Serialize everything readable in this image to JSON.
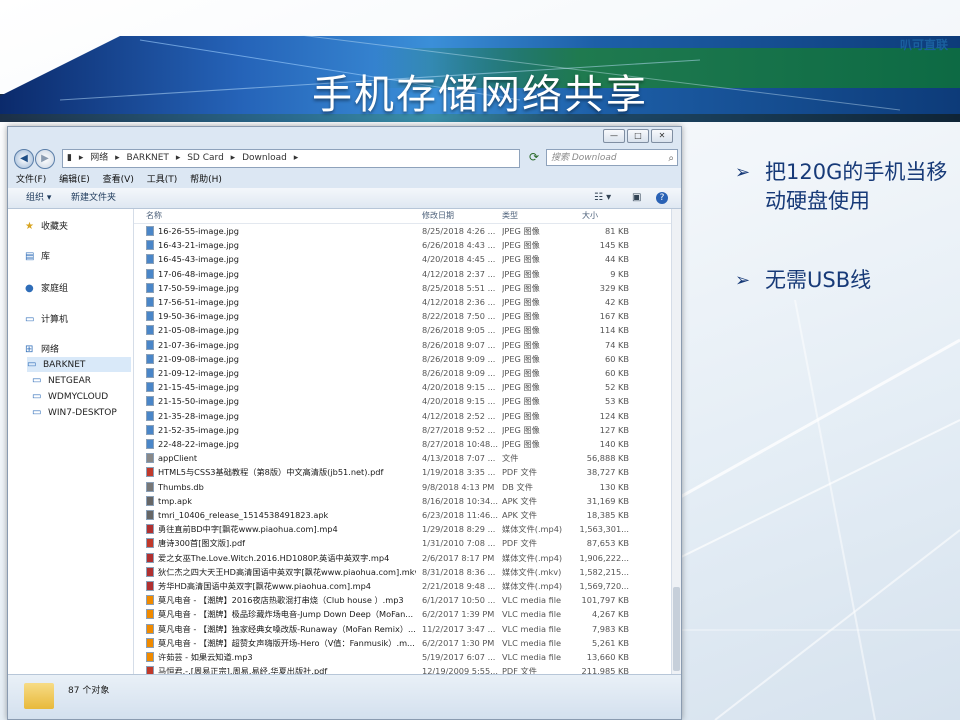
{
  "slide": {
    "brand": "叭可直联",
    "title": "手机存储网络共享",
    "bullets": [
      {
        "marker": "➢",
        "text": "把120G的手机当移动硬盘使用"
      },
      {
        "marker": "➢",
        "text": "无需USB线"
      }
    ]
  },
  "window": {
    "controls": {
      "minimize": "—",
      "maximize": "□",
      "close": "✕"
    },
    "breadcrumb": [
      "网络",
      "BARKNET",
      "SD Card",
      "Download"
    ],
    "search_placeholder": "搜索 Download",
    "menu": [
      "文件(F)",
      "编辑(E)",
      "查看(V)",
      "工具(T)",
      "帮助(H)"
    ],
    "commands": {
      "organize": "组织 ▾",
      "new_folder": "新建文件夹"
    },
    "columns": {
      "name": "名称",
      "date": "修改日期",
      "type": "类型",
      "size": "大小"
    },
    "nav": {
      "favorites": "收藏夹",
      "libraries": "库",
      "homegroup": "家庭组",
      "computer": "计算机",
      "network": "网络",
      "hosts": [
        "BARKNET",
        "NETGEAR",
        "WDMYCLOUD",
        "WIN7-DESKTOP"
      ]
    },
    "files": [
      {
        "name": "16-26-55-image.jpg",
        "date": "8/25/2018 4:26 ...",
        "type": "JPEG 图像",
        "size": "81 KB"
      },
      {
        "name": "16-43-21-image.jpg",
        "date": "6/26/2018 4:43 ...",
        "type": "JPEG 图像",
        "size": "145 KB"
      },
      {
        "name": "16-45-43-image.jpg",
        "date": "4/20/2018 4:45 ...",
        "type": "JPEG 图像",
        "size": "44 KB"
      },
      {
        "name": "17-06-48-image.jpg",
        "date": "4/12/2018 2:37 ...",
        "type": "JPEG 图像",
        "size": "9 KB"
      },
      {
        "name": "17-50-59-image.jpg",
        "date": "8/25/2018 5:51 ...",
        "type": "JPEG 图像",
        "size": "329 KB"
      },
      {
        "name": "17-56-51-image.jpg",
        "date": "4/12/2018 2:36 ...",
        "type": "JPEG 图像",
        "size": "42 KB"
      },
      {
        "name": "19-50-36-image.jpg",
        "date": "8/22/2018 7:50 ...",
        "type": "JPEG 图像",
        "size": "167 KB"
      },
      {
        "name": "21-05-08-image.jpg",
        "date": "8/26/2018 9:05 ...",
        "type": "JPEG 图像",
        "size": "114 KB"
      },
      {
        "name": "21-07-36-image.jpg",
        "date": "8/26/2018 9:07 ...",
        "type": "JPEG 图像",
        "size": "74 KB"
      },
      {
        "name": "21-09-08-image.jpg",
        "date": "8/26/2018 9:09 ...",
        "type": "JPEG 图像",
        "size": "60 KB"
      },
      {
        "name": "21-09-12-image.jpg",
        "date": "8/26/2018 9:09 ...",
        "type": "JPEG 图像",
        "size": "60 KB"
      },
      {
        "name": "21-15-45-image.jpg",
        "date": "4/20/2018 9:15 ...",
        "type": "JPEG 图像",
        "size": "52 KB"
      },
      {
        "name": "21-15-50-image.jpg",
        "date": "4/20/2018 9:15 ...",
        "type": "JPEG 图像",
        "size": "53 KB"
      },
      {
        "name": "21-35-28-image.jpg",
        "date": "4/12/2018 2:52 ...",
        "type": "JPEG 图像",
        "size": "124 KB"
      },
      {
        "name": "21-52-35-image.jpg",
        "date": "8/27/2018 9:52 ...",
        "type": "JPEG 图像",
        "size": "127 KB"
      },
      {
        "name": "22-48-22-image.jpg",
        "date": "8/27/2018 10:48...",
        "type": "JPEG 图像",
        "size": "140 KB"
      },
      {
        "name": "appClient",
        "date": "4/13/2018 7:07 ...",
        "type": "文件",
        "size": "56,888 KB"
      },
      {
        "name": "HTML5与CSS3基础教程（第8版）中文高清版(jb51.net).pdf",
        "date": "1/19/2018 3:35 ...",
        "type": "PDF 文件",
        "size": "38,727 KB"
      },
      {
        "name": "Thumbs.db",
        "date": "9/8/2018 4:13 PM",
        "type": "DB 文件",
        "size": "130 KB"
      },
      {
        "name": "tmp.apk",
        "date": "8/16/2018 10:34...",
        "type": "APK 文件",
        "size": "31,169 KB"
      },
      {
        "name": "tmri_10406_release_1514538491823.apk",
        "date": "6/23/2018 11:46...",
        "type": "APK 文件",
        "size": "18,385 KB"
      },
      {
        "name": "勇往直前BD中字[飘花www.piaohua.com].mp4",
        "date": "1/29/2018 8:29 ...",
        "type": "媒体文件(.mp4)",
        "size": "1,563,301..."
      },
      {
        "name": "唐诗300首[图文版].pdf",
        "date": "1/31/2010 7:08 ...",
        "type": "PDF 文件",
        "size": "87,653 KB"
      },
      {
        "name": "爱之女巫The.Love.Witch.2016.HD1080P.英语中英双字.mp4",
        "date": "2/6/2017 8:17 PM",
        "type": "媒体文件(.mp4)",
        "size": "1,906,222..."
      },
      {
        "name": "狄仁杰之四大天王HD高清国语中英双字[飘花www.piaohua.com].mkv",
        "date": "8/31/2018 8:36 ...",
        "type": "媒体文件(.mkv)",
        "size": "1,582,215..."
      },
      {
        "name": "芳华HD高清国语中英双字[飘花www.piaohua.com].mp4",
        "date": "2/21/2018 9:48 ...",
        "type": "媒体文件(.mp4)",
        "size": "1,569,720..."
      },
      {
        "name": "莫凡电音 - 【潮牌】2016夜店热歌混打串烧（Club house ）.mp3",
        "date": "6/1/2017 10:50 ...",
        "type": "VLC media file",
        "size": "101,797 KB"
      },
      {
        "name": "莫凡电音 - 【潮牌】极品珍藏炸场电音-Jump Down Deep（MoFan...",
        "date": "6/2/2017 1:39 PM",
        "type": "VLC media file",
        "size": "4,267 KB"
      },
      {
        "name": "莫凡电音 - 【潮牌】独家经典女嗓改版-Runaway（MoFan Remix）...",
        "date": "11/2/2017 3:47 ...",
        "type": "VLC media file",
        "size": "7,983 KB"
      },
      {
        "name": "莫凡电音 - 【潮牌】超赞女声嗨版开场-Hero（V值：Fanmusik）.m...",
        "date": "6/2/2017 1:30 PM",
        "type": "VLC media file",
        "size": "5,261 KB"
      },
      {
        "name": "许茹芸 - 如果云知道.mp3",
        "date": "5/19/2017 6:07 ...",
        "type": "VLC media file",
        "size": "13,660 KB"
      },
      {
        "name": "马恒君.-.[周易正宗].周易.易经.华夏出版社.pdf",
        "date": "12/19/2009 5:55...",
        "type": "PDF 文件",
        "size": "211,985 KB"
      }
    ],
    "status": "87 个对象"
  }
}
